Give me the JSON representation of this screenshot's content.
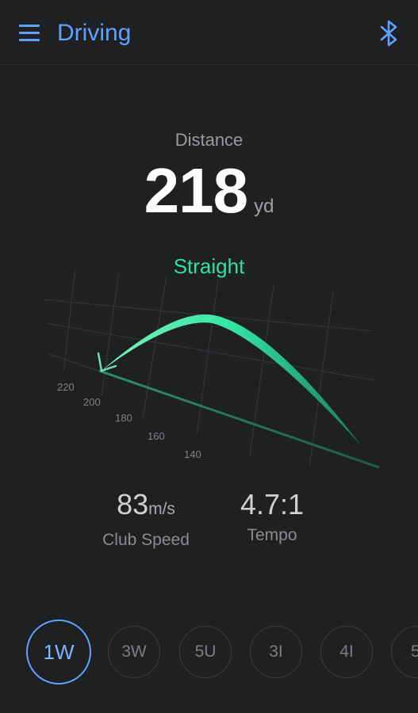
{
  "appbar": {
    "title": "Driving",
    "menu_icon": "hamburger-menu-icon",
    "bluetooth_icon": "bluetooth-icon",
    "accent_color": "#5ea2ff"
  },
  "distance": {
    "label": "Distance",
    "value": "218",
    "unit": "yd"
  },
  "shot": {
    "type": "Straight",
    "color": "#2fe0a2"
  },
  "trajectory_chart": {
    "grid_labels": [
      "220",
      "200",
      "180",
      "160",
      "140"
    ]
  },
  "stats": {
    "club_speed": {
      "value": "83",
      "unit": "m/s",
      "label": "Club Speed"
    },
    "tempo": {
      "value": "4.7:1",
      "label": "Tempo"
    }
  },
  "clubs": {
    "selected": "1W",
    "items": [
      "1W",
      "3W",
      "5U",
      "3I",
      "4I",
      "5"
    ]
  }
}
